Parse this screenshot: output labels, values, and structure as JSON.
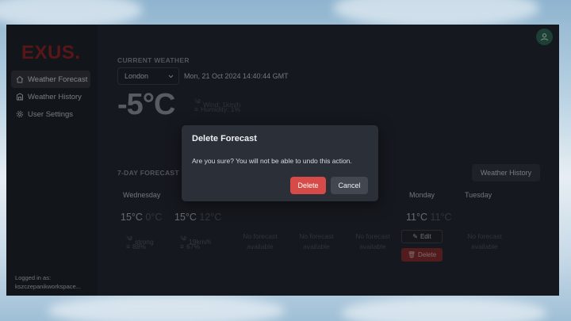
{
  "brand": {
    "logo_text": "EXUS.",
    "accent": "#e23b3b"
  },
  "sidebar": {
    "items": [
      {
        "label": "Weather Forecast",
        "icon": "home-icon",
        "active": true
      },
      {
        "label": "Weather History",
        "icon": "building-icon",
        "active": false
      },
      {
        "label": "User Settings",
        "icon": "gear-icon",
        "active": false
      }
    ],
    "logged_in_label": "Logged in as:",
    "logged_in_user": "kszczepanikworkspace..."
  },
  "current": {
    "section_title": "CURRENT WEATHER",
    "city": "London",
    "datetime": "Mon, 21 Oct 2024 14:40:44 GMT",
    "temperature": "-5°C",
    "wind": "Wind: 1km/h",
    "humidity": "Humidity: 1%"
  },
  "forecast": {
    "section_title": "7-DAY FORECAST",
    "history_button": "Weather History",
    "days": [
      {
        "name": "Wednesday",
        "max": "15°C",
        "min": "0°C",
        "wind": "strong",
        "humidity": "88%"
      },
      {
        "name": "",
        "max": "15°C",
        "min": "12°C",
        "wind": "19km/h",
        "humidity": "67%"
      },
      {
        "name": "",
        "no_forecast": "No forecast available"
      },
      {
        "name": "",
        "no_forecast": "No forecast available"
      },
      {
        "name": "",
        "no_forecast": "No forecast available"
      },
      {
        "name": "Monday",
        "max": "11°C",
        "min": "11°C",
        "edit_label": "Edit",
        "delete_label": "Delete"
      },
      {
        "name": "Tuesday",
        "no_forecast": "No forecast available"
      }
    ]
  },
  "modal": {
    "title": "Delete Forecast",
    "body": "Are you sure? You will not be able to undo this action.",
    "confirm_label": "Delete",
    "cancel_label": "Cancel"
  }
}
